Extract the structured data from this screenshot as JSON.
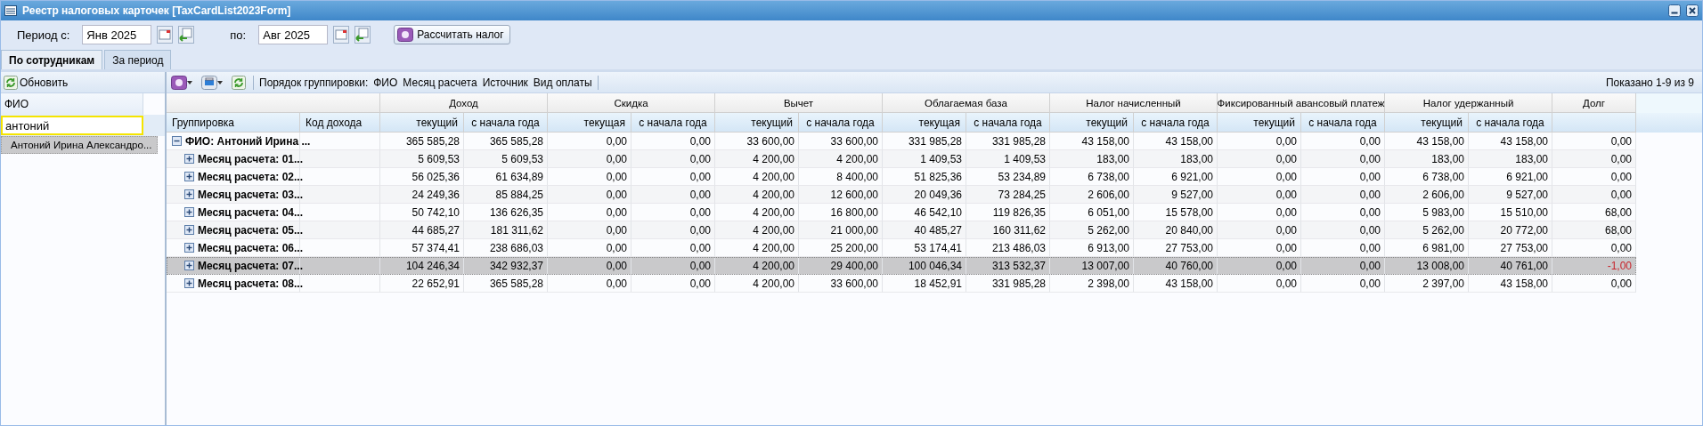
{
  "window": {
    "title": "Реестр налоговых карточек [TaxCardList2023Form]"
  },
  "period": {
    "from_label": "Период с:",
    "from": "Янв 2025",
    "to_label": "по:",
    "to": "Авг 2025",
    "calc_button": "Рассчитать налог"
  },
  "tabs": [
    {
      "label": "По сотрудникам",
      "selected": true
    },
    {
      "label": "За период",
      "selected": false
    }
  ],
  "left_panel": {
    "refresh_button": "Обновить",
    "column": "ФИО",
    "filter_value": "антоний",
    "items": [
      {
        "label": "Антоний Ирина Александро...",
        "selected": true
      }
    ]
  },
  "grid_toolbar": {
    "grouping_label": "Порядок группировки:",
    "grouping_items": [
      "ФИО",
      "Месяц расчета",
      "Источник",
      "Вид оплаты"
    ],
    "paging": "Показано 1-9 из 9"
  },
  "table": {
    "fixed_columns": [
      "Группировка",
      "Код дохода"
    ],
    "groups": [
      {
        "label": "Доход",
        "columns": [
          "текущий",
          "с начала года"
        ]
      },
      {
        "label": "Скидка",
        "columns": [
          "текущая",
          "с начала года"
        ]
      },
      {
        "label": "Вычет",
        "columns": [
          "текущий",
          "с начала года"
        ]
      },
      {
        "label": "Облагаемая база",
        "columns": [
          "текущая",
          "с начала года"
        ]
      },
      {
        "label": "Налог начисленный",
        "columns": [
          "текущий",
          "с начала года"
        ]
      },
      {
        "label": "Фиксированный авансовый платеж",
        "columns": [
          "текущий",
          "с начала года"
        ]
      },
      {
        "label": "Налог удержанный",
        "columns": [
          "текущий",
          "с начала года"
        ]
      },
      {
        "label": "Долг"
      }
    ],
    "rows": [
      {
        "label": "ФИО: Антоний Ирина ...",
        "expanded": true,
        "selected": false,
        "debt_overpaid": false,
        "cells": [
          "365 585,28",
          "365 585,28",
          "0,00",
          "0,00",
          "33 600,00",
          "33 600,00",
          "331 985,28",
          "331 985,28",
          "43 158,00",
          "43 158,00",
          "0,00",
          "0,00",
          "43 158,00",
          "43 158,00",
          "0,00"
        ],
        "children": [
          {
            "label": "Месяц расчета: 01...",
            "expanded": false,
            "selected": false,
            "debt_overpaid": false,
            "cells": [
              "5 609,53",
              "5 609,53",
              "0,00",
              "0,00",
              "4 200,00",
              "4 200,00",
              "1 409,53",
              "1 409,53",
              "183,00",
              "183,00",
              "0,00",
              "0,00",
              "183,00",
              "183,00",
              "0,00"
            ]
          },
          {
            "label": "Месяц расчета: 02...",
            "expanded": false,
            "selected": false,
            "debt_overpaid": false,
            "cells": [
              "56 025,36",
              "61 634,89",
              "0,00",
              "0,00",
              "4 200,00",
              "8 400,00",
              "51 825,36",
              "53 234,89",
              "6 738,00",
              "6 921,00",
              "0,00",
              "0,00",
              "6 738,00",
              "6 921,00",
              "0,00"
            ]
          },
          {
            "label": "Месяц расчета: 03...",
            "expanded": false,
            "selected": false,
            "debt_overpaid": false,
            "cells": [
              "24 249,36",
              "85 884,25",
              "0,00",
              "0,00",
              "4 200,00",
              "12 600,00",
              "20 049,36",
              "73 284,25",
              "2 606,00",
              "9 527,00",
              "0,00",
              "0,00",
              "2 606,00",
              "9 527,00",
              "0,00"
            ]
          },
          {
            "label": "Месяц расчета: 04...",
            "expanded": false,
            "selected": false,
            "debt_overpaid": false,
            "cells": [
              "50 742,10",
              "136 626,35",
              "0,00",
              "0,00",
              "4 200,00",
              "16 800,00",
              "46 542,10",
              "119 826,35",
              "6 051,00",
              "15 578,00",
              "0,00",
              "0,00",
              "5 983,00",
              "15 510,00",
              "68,00"
            ]
          },
          {
            "label": "Месяц расчета: 05...",
            "expanded": false,
            "selected": false,
            "debt_overpaid": false,
            "cells": [
              "44 685,27",
              "181 311,62",
              "0,00",
              "0,00",
              "4 200,00",
              "21 000,00",
              "40 485,27",
              "160 311,62",
              "5 262,00",
              "20 840,00",
              "0,00",
              "0,00",
              "5 262,00",
              "20 772,00",
              "68,00"
            ]
          },
          {
            "label": "Месяц расчета: 06...",
            "expanded": false,
            "selected": false,
            "debt_overpaid": false,
            "cells": [
              "57 374,41",
              "238 686,03",
              "0,00",
              "0,00",
              "4 200,00",
              "25 200,00",
              "53 174,41",
              "213 486,03",
              "6 913,00",
              "27 753,00",
              "0,00",
              "0,00",
              "6 981,00",
              "27 753,00",
              "0,00"
            ]
          },
          {
            "label": "Месяц расчета: 07...",
            "expanded": false,
            "selected": true,
            "debt_overpaid": true,
            "cells": [
              "104 246,34",
              "342 932,37",
              "0,00",
              "0,00",
              "4 200,00",
              "29 400,00",
              "100 046,34",
              "313 532,37",
              "13 007,00",
              "40 760,00",
              "0,00",
              "0,00",
              "13 008,00",
              "40 761,00",
              "-1,00"
            ]
          },
          {
            "label": "Месяц расчета: 08...",
            "expanded": false,
            "selected": false,
            "debt_overpaid": false,
            "cells": [
              "22 652,91",
              "365 585,28",
              "0,00",
              "0,00",
              "4 200,00",
              "33 600,00",
              "18 452,91",
              "331 985,28",
              "2 398,00",
              "43 158,00",
              "0,00",
              "0,00",
              "2 397,00",
              "43 158,00",
              "0,00"
            ]
          }
        ]
      }
    ]
  }
}
